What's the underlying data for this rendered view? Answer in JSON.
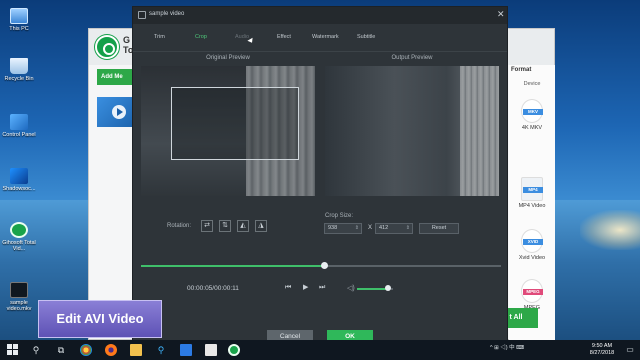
{
  "desktop": {
    "icons": [
      {
        "label": "This PC",
        "icon": "computer-icon"
      },
      {
        "label": "Recycle Bin",
        "icon": "recycle-bin-icon"
      },
      {
        "label": "Control Panel",
        "icon": "control-panel-icon"
      },
      {
        "label": "Shadowsoc...",
        "icon": "shortcut-icon"
      },
      {
        "label": "Gihosoft Total Vid...",
        "icon": "gihosoft-icon"
      },
      {
        "label": "sample video.mkv",
        "icon": "video-file-icon"
      }
    ]
  },
  "back_app": {
    "title_line1": "G",
    "title_line2": "To",
    "add_media_label": "Add Me",
    "format_header": "Format",
    "device_label": "Device",
    "formats": [
      {
        "tag": "MKV",
        "label": "4K MKV",
        "color": "#3b8de0",
        "top": "4K"
      },
      {
        "tag": "MP4",
        "label": "MP4 Video",
        "color": "#3b8de0",
        "top": "HD"
      },
      {
        "tag": "XVID",
        "label": "Xvid Video",
        "color": "#3b8de0",
        "top": ""
      },
      {
        "tag": "MPEG",
        "label": "MPEG",
        "color": "#e04a7a",
        "top": ""
      }
    ],
    "convert_label": "t All"
  },
  "dialog": {
    "title": "sample video",
    "close_glyph": "✕",
    "tabs": [
      "Trim",
      "Crop",
      "Audio",
      "Effect",
      "Watermark",
      "Subtitle"
    ],
    "active_tab": "Crop",
    "original_preview_label": "Original Preview",
    "output_preview_label": "Output Preview",
    "rotation_label": "Rotation:",
    "rotation_buttons": [
      "⇄",
      "⇅",
      "◭",
      "◮"
    ],
    "crop_size_label": "Crop Size:",
    "crop_width": "938",
    "crop_height": "412",
    "x_label": "X",
    "reset_label": "Reset",
    "timecode": "00:00:05/00:00:11",
    "seek_progress": 0.51,
    "volume_level": 0.85,
    "cancel_label": "Cancel",
    "ok_label": "OK"
  },
  "caption": {
    "text": "Edit AVI Video"
  },
  "taskbar": {
    "clock_time": "9:50 AM",
    "clock_date": "8/27/2018",
    "tray_text": "^  ⊞  ◁)  中  ⌨"
  }
}
